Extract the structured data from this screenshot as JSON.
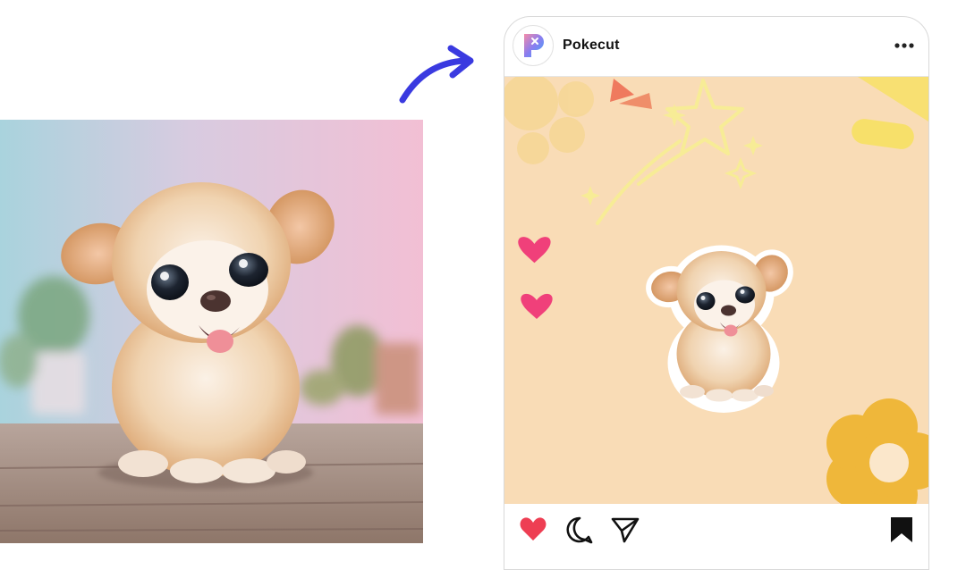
{
  "post": {
    "account_name": "Pokecut"
  },
  "icons": {
    "avatar": "pokecut-logo-icon",
    "more": "more-options-icon",
    "like": "heart-icon",
    "comment": "comment-icon",
    "share": "share-icon",
    "save": "bookmark-icon",
    "arrow": "curved-arrow-icon"
  },
  "colors": {
    "arrow": "#3a3ae0",
    "like": "#ee3e53",
    "post_background": "#f9dcb6",
    "flower": "#efb73a",
    "heart_accent": "#f0407a"
  }
}
